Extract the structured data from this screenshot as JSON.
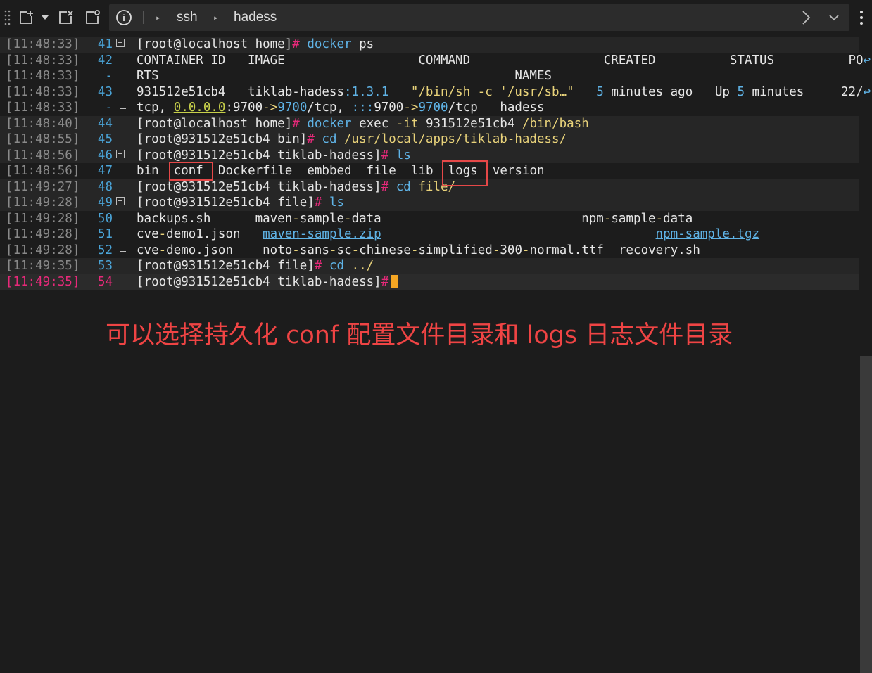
{
  "toolbar": {
    "icons": [
      "drag-handle-icon",
      "new-tab-icon",
      "chevron-down-icon",
      "close-tab-icon",
      "settings-tab-icon",
      "info-icon"
    ],
    "breadcrumb": [
      "ssh",
      "hadess"
    ],
    "right_icons": [
      "chevron-right-icon",
      "chevron-down-icon",
      "more-icon"
    ]
  },
  "colors": {
    "accent": "#e8297a",
    "command": "#5fb3e6",
    "string": "#e8d27a",
    "annotation": "#ef4444",
    "cursor": "#f5a623"
  },
  "lines": [
    {
      "ts": "[11:48:33]",
      "ln": "41",
      "gutter": "fold",
      "hl": true
    },
    {
      "ts": "[11:48:33]",
      "ln": "42",
      "gutter": "line"
    },
    {
      "ts": "[11:48:33]",
      "ln": "-",
      "gutter": "line"
    },
    {
      "ts": "[11:48:33]",
      "ln": "43",
      "gutter": "line"
    },
    {
      "ts": "[11:48:33]",
      "ln": "-",
      "gutter": "corner"
    },
    {
      "ts": "[11:48:40]",
      "ln": "44",
      "gutter": "",
      "hl": true
    },
    {
      "ts": "[11:48:55]",
      "ln": "45",
      "gutter": "",
      "hl": true
    },
    {
      "ts": "[11:48:56]",
      "ln": "46",
      "gutter": "fold",
      "hl": true
    },
    {
      "ts": "[11:48:56]",
      "ln": "47",
      "gutter": "corner"
    },
    {
      "ts": "[11:49:27]",
      "ln": "48",
      "gutter": "",
      "hl": true
    },
    {
      "ts": "[11:49:28]",
      "ln": "49",
      "gutter": "fold",
      "hl": true
    },
    {
      "ts": "[11:49:28]",
      "ln": "50",
      "gutter": "line"
    },
    {
      "ts": "[11:49:28]",
      "ln": "51",
      "gutter": "line"
    },
    {
      "ts": "[11:49:28]",
      "ln": "52",
      "gutter": "corner"
    },
    {
      "ts": "[11:49:35]",
      "ln": "53",
      "gutter": "",
      "hl": true
    },
    {
      "ts": "[11:49:35]",
      "ln": "54",
      "gutter": "",
      "cur": true
    }
  ],
  "terminal": {
    "l41": {
      "prompt": "[root@localhost home]",
      "hash": "#",
      "cmd": "docker",
      "arg": " ps"
    },
    "l42": "CONTAINER ID   IMAGE                  COMMAND                  CREATED          STATUS          PO",
    "l42_wrap": "↩",
    "l42b": "RTS                                                NAMES",
    "l43": {
      "id": "931512e51cb4   tiklab-hadess",
      "colon": ":",
      "ver": "1.3.1",
      "sp1": "   ",
      "q1": "\"/bin/sh -c ",
      "q2": "'/usr/sb…\"",
      "sp2": "   ",
      "five": "5",
      "created": " minutes ago   Up ",
      "five2": "5",
      "status": " minutes     22/",
      "wrap": "↩"
    },
    "l43b": {
      "pre": "tcp, ",
      "ip": "0.0.0.0",
      "p1": ":9700",
      "arr": "->",
      "p2": "9700",
      "mid": "/tcp, ",
      "ip2": ":::",
      "p3": "9700",
      "arr2": "->",
      "p4": "9700",
      "end": "/tcp   hadess"
    },
    "l44": {
      "prompt": "[root@localhost home]",
      "hash": "#",
      "cmd": " docker",
      "rest": " exec ",
      "flag": "-it",
      "rest2": " 931512e51cb4 ",
      "path": "/bin/bash"
    },
    "l45": {
      "prompt": "[root@931512e51cb4 bin]",
      "hash": "#",
      "cmd": " cd",
      "path": " /usr/local/apps/tiklab-hadess/"
    },
    "l46": {
      "prompt": "[root@931512e51cb4 tiklab-hadess]",
      "hash": "#",
      "cmd": " ls"
    },
    "l47": [
      "bin",
      "conf",
      "Dockerfile",
      "embbed",
      "file",
      "lib",
      "logs",
      "version"
    ],
    "l48": {
      "prompt": "[root@931512e51cb4 tiklab-hadess]",
      "hash": "#",
      "cmd": " cd",
      "path": " file/"
    },
    "l49": {
      "prompt": "[root@931512e51cb4 file]",
      "hash": "#",
      "cmd": " ls"
    },
    "l50": [
      "backups.sh",
      "maven",
      "-",
      "sample",
      "-",
      "data",
      "npm",
      "-",
      "sample",
      "-",
      "data"
    ],
    "l51": [
      "cve",
      "-",
      "demo1.json",
      "maven-sample.zip",
      "npm-sample.tgz"
    ],
    "l52": [
      "cve",
      "-",
      "demo.json",
      "noto",
      "-",
      "sans",
      "-",
      "sc",
      "-",
      "chinese",
      "-",
      "simplified",
      "-",
      "300",
      "-",
      "normal.ttf",
      "recovery.sh"
    ],
    "l53": {
      "prompt": "[root@931512e51cb4 file]",
      "hash": "#",
      "cmd": " cd",
      "path": " ../"
    },
    "l54": {
      "prompt": "[root@931512e51cb4 tiklab-hadess]",
      "hash": "#"
    }
  },
  "annotation": "可以选择持久化 conf 配置文件目录和 logs 日志文件目录"
}
